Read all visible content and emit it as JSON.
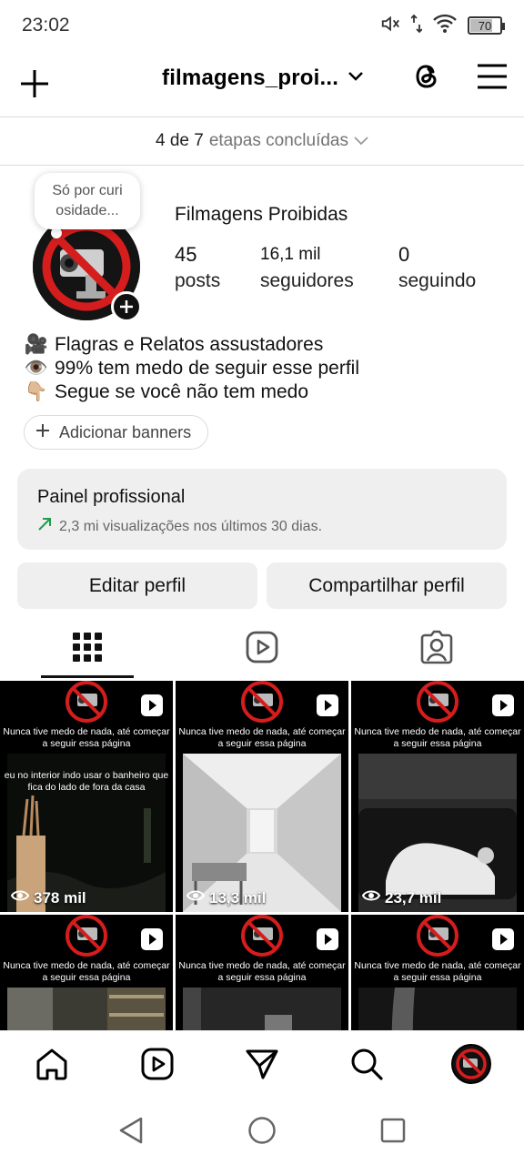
{
  "status_bar": {
    "time": "23:02",
    "battery": "70",
    "battery_level": 0.7
  },
  "header": {
    "username": "filmagens_proi...",
    "icons": [
      "plus-icon",
      "chevron-down-icon",
      "threads-icon",
      "menu-icon"
    ]
  },
  "steps": {
    "count": "4 de 7",
    "label": "etapas concluídas"
  },
  "profile": {
    "note": "Só por curi osidade...",
    "display_name": "Filmagens Proibidas",
    "stats": [
      {
        "value": "45",
        "label": "posts"
      },
      {
        "value": "16,1 mil",
        "label": "seguidores"
      },
      {
        "value": "0",
        "label": "seguindo"
      }
    ],
    "bio": [
      {
        "emoji": "🎥",
        "text": "Flagras e Relatos assustadores"
      },
      {
        "emoji": "👁️",
        "text": "99% tem medo de seguir esse perfil"
      },
      {
        "emoji": "👇🏼",
        "text": "Segue se você não tem medo"
      }
    ]
  },
  "banner_button": {
    "label": "Adicionar banners"
  },
  "pro_panel": {
    "title": "Painel profissional",
    "subtitle": "2,3 mi visualizações nos últimos 30 dias."
  },
  "actions": {
    "edit": "Editar perfil",
    "share": "Compartilhar perfil"
  },
  "tabs": [
    "grid-icon",
    "reels-icon",
    "tagged-icon"
  ],
  "grid": [
    {
      "caption": "Nunca tive medo de nada, até começar a seguir essa página",
      "views": "378 mil",
      "overlay": "eu no interior indo usar o banheiro que fica do lado de fora da casa"
    },
    {
      "caption": "Nunca tive medo de nada, até começar a seguir essa página",
      "views": "13,3 mil",
      "overlay": ""
    },
    {
      "caption": "Nunca tive medo de nada, até começar a seguir essa página",
      "views": "23,7 mil",
      "overlay": ""
    },
    {
      "caption": "Nunca tive medo de nada, até começar a seguir essa página",
      "views": "",
      "overlay": ""
    },
    {
      "caption": "Nunca tive medo de nada, até começar a seguir essa página",
      "views": "",
      "overlay": ""
    },
    {
      "caption": "Nunca tive medo de nada, até começar a seguir essa página",
      "views": "",
      "overlay": ""
    }
  ],
  "bottom_nav": [
    "home-icon",
    "reels-icon",
    "direct-icon",
    "search-icon",
    "profile-avatar"
  ],
  "system_nav": [
    "back-icon",
    "home-circle-icon",
    "recents-icon"
  ],
  "colors": {
    "accent_green": "#1f9e4b",
    "panel_bg": "#efefef",
    "divider": "#dbdbdb"
  }
}
